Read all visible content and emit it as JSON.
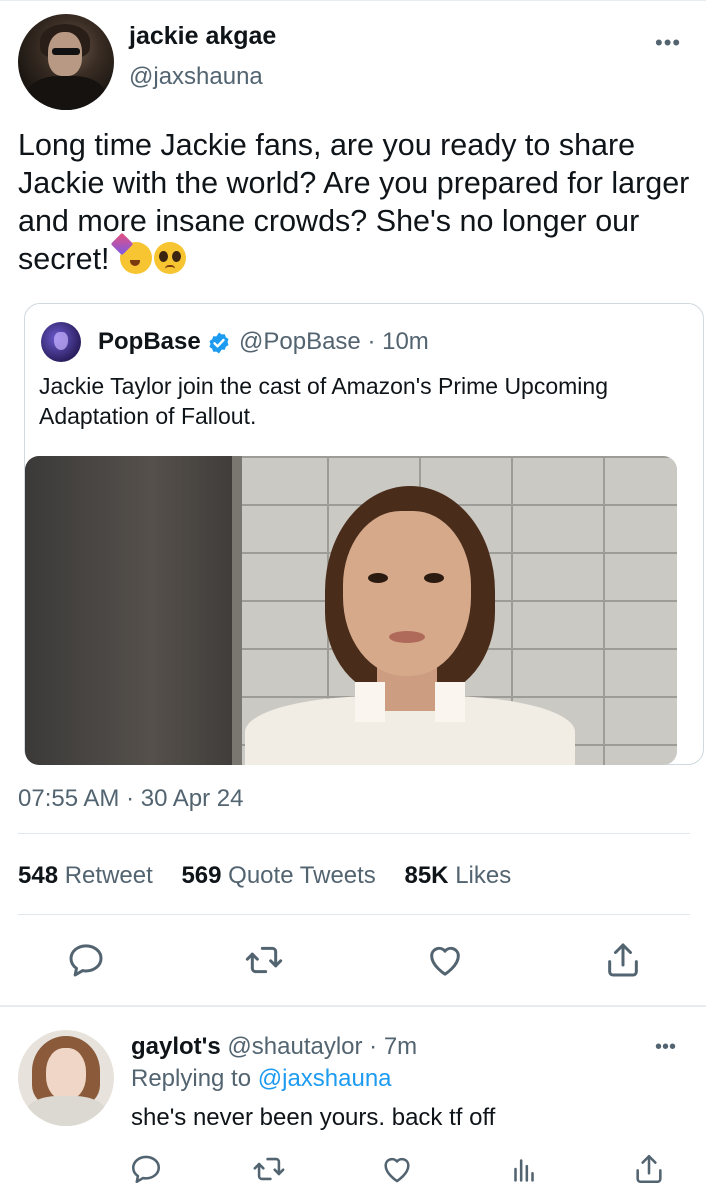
{
  "tweet": {
    "author_name": "jackie akgae",
    "author_handle": "@jaxshauna",
    "more": "•••",
    "text": "Long time Jackie fans, are you ready to share Jackie with the world? Are you prepared for larger and more insane crowds? She's no longer our secret!",
    "emojis": [
      "partying-face",
      "pleading-face"
    ],
    "timestamp": "07:55 AM · 30 Apr 24"
  },
  "quote": {
    "author_name": "PopBase",
    "author_meta": "@PopBase · 10m",
    "text": "Jackie Taylor join the cast of Amazon's Prime Upcoming Adaptation of Fallout."
  },
  "stats": {
    "retweets_count": "548",
    "retweets_label": "Retweet",
    "quotes_count": "569",
    "quotes_label": "Quote Tweets",
    "likes_count": "85K",
    "likes_label": "Likes"
  },
  "reply": {
    "author_name": "gaylot's",
    "author_meta": "@shautaylor · 7m",
    "replying_prefix": "Replying to",
    "replying_handle": "@jaxshauna",
    "text": "she's never been yours. back tf off",
    "more": "•••"
  },
  "colors": {
    "text": "#0f1419",
    "secondary": "#536471",
    "accent": "#1d9bf0",
    "border": "#cfd9de"
  }
}
